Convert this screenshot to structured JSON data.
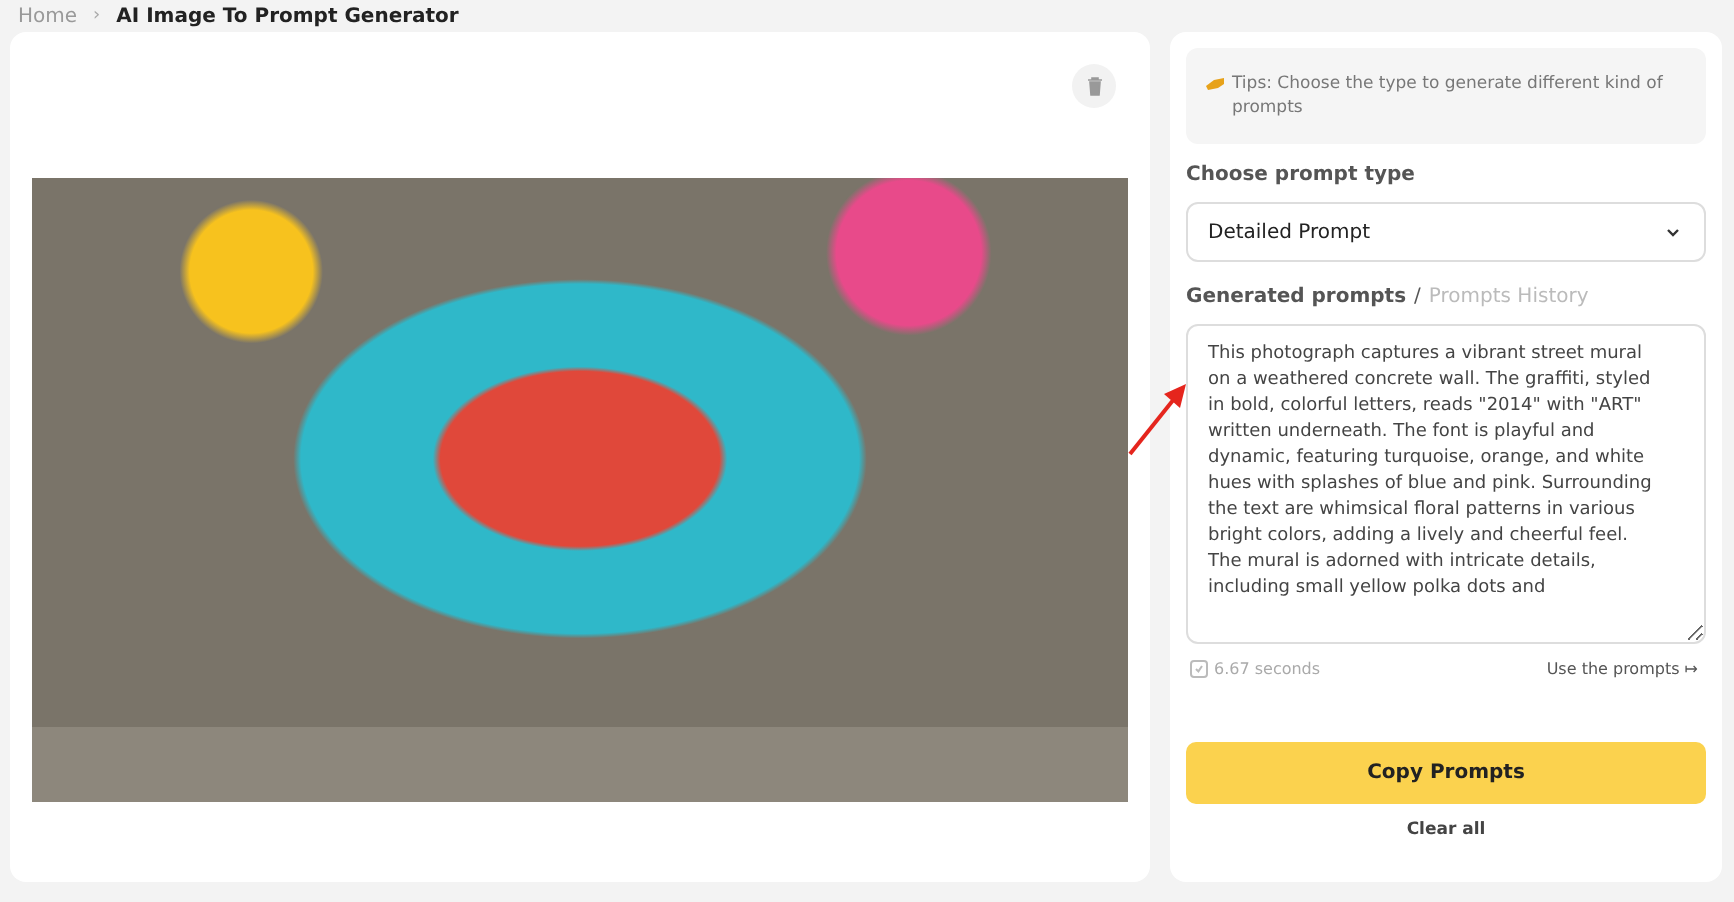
{
  "breadcrumb": [
    {
      "label": "Home"
    },
    {
      "label": "AI Image To Prompt Generator"
    }
  ],
  "breadcrumb_separator": "›",
  "tab_separator": "/",
  "tips": "Tips: Choose the type to generate different kind of prompts",
  "prompt_type": {
    "label": "Choose prompt type",
    "value": "Detailed Prompt"
  },
  "output_tabs": [
    {
      "label": "Generated prompts",
      "selected": true
    },
    {
      "label": "Prompts History",
      "selected": false
    }
  ],
  "prompt_text": "This photograph captures a vibrant street mural on a weathered concrete wall. The graffiti, styled in bold, colorful letters, reads \"2014\" with \"ART\" written underneath. The font is playful and dynamic, featuring turquoise, orange, and white hues with splashes of blue and pink. Surrounding the text are whimsical floral patterns in various bright colors, adding a lively and cheerful feel. The mural is adorned with intricate details, including small yellow polka dots and",
  "duration": "6.67 seconds",
  "use_link": "Use the prompts ↦",
  "copy_button": "Copy Prompts",
  "clear_button": "Clear all"
}
